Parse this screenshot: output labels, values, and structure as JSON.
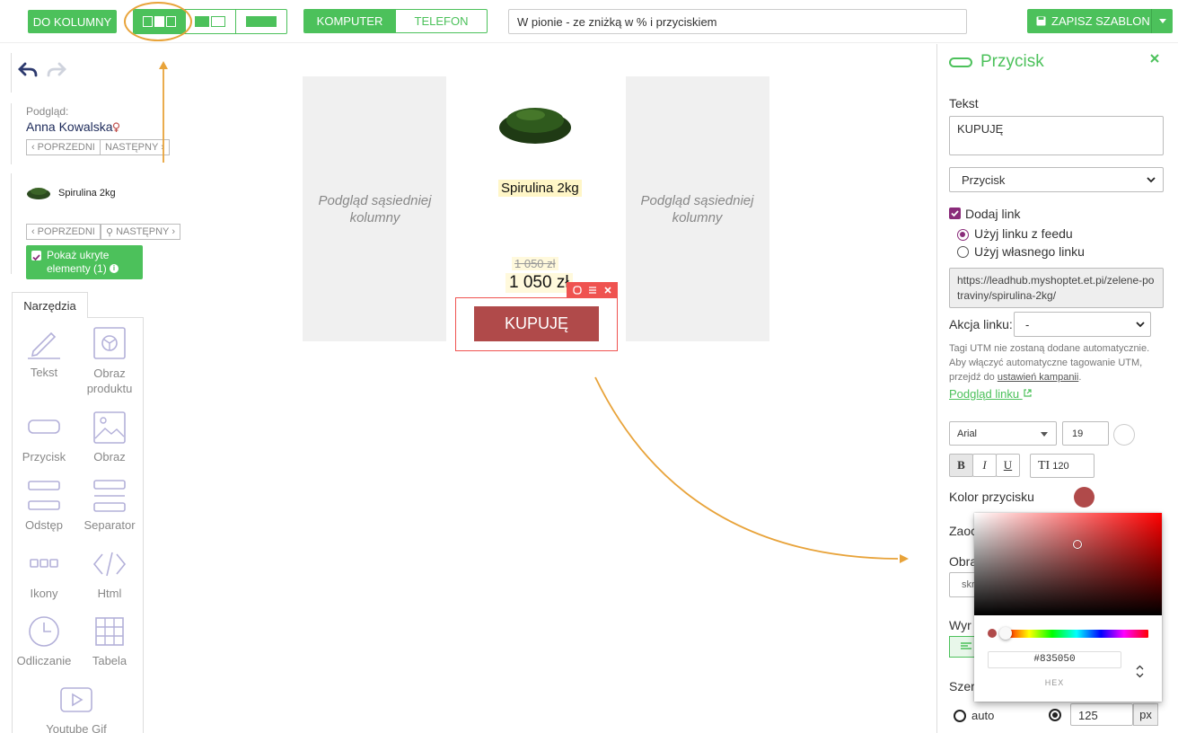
{
  "topbar": {
    "to_columns": "DO KOLUMNY",
    "device_computer": "KOMPUTER",
    "device_phone": "TELEFON",
    "template_name": "W pionie - ze zniżką w % i przyciskiem",
    "save_template": "ZAPISZ SZABLON"
  },
  "left": {
    "preview_label": "Podgląd:",
    "preview_name": "Anna Kowalska",
    "prev": "POPRZEDNI",
    "next": "NASTĘPNY",
    "product_name": "Spirulina 2kg",
    "prev2": "POPRZEDNI",
    "next2": "NASTĘPNY",
    "hidden_toggle": "Pokaż ukryte elementy (1)",
    "tools_tab": "Narzędzia",
    "tools": {
      "text": "Tekst",
      "product_image": "Obraz produktu",
      "button": "Przycisk",
      "image": "Obraz",
      "spacer": "Odstęp",
      "separator": "Separator",
      "icons": "Ikony",
      "html": "Html",
      "countdown": "Odliczanie",
      "table": "Tabela",
      "youtube": "Youtube Gif"
    }
  },
  "canvas": {
    "adjacent_preview": "Podgląd sąsiedniej kolumny",
    "product_title": "Spirulina 2kg",
    "old_price": "1 050 zł",
    "price": "1 050 zł",
    "cta": "KUPUJĘ"
  },
  "panel": {
    "title": "Przycisk",
    "text_label": "Tekst",
    "text_value": "KUPUJĘ",
    "type_select": "Przycisk",
    "add_link": "Dodaj link",
    "use_feed_link": "Użyj linku z feedu",
    "use_own_link": "Użyj własnego linku",
    "url": "https://leadhub.myshoptet.et.pi/zelene-potraviny/spirulina-2kg/",
    "link_action_label": "Akcja linku:",
    "link_action_value": "-",
    "utm_note_1": "Tagi UTM nie zostaną dodane automatycznie.",
    "utm_note_2": "Aby włączyć automatyczne tagowanie UTM,",
    "utm_note_3": "przejdź do",
    "utm_link": "ustawień kampanii",
    "utm_note_end": ".",
    "preview_link": "Podgląd linku",
    "font": "Arial",
    "font_size": "19",
    "bold": "B",
    "italic": "I",
    "underline": "U",
    "line_height_icon": "TI",
    "line_height": "120",
    "button_color_label": "Kolor przycisku",
    "cut_zaoc": "Zaoc",
    "cut_obra": "Obra",
    "cut_skr": "skr",
    "cut_wyr": "Wyr",
    "cut_szer": "Szer",
    "width_auto": "auto",
    "width_value": "125",
    "width_unit": "px",
    "hex_value": "#835050",
    "hex_label": "HEX"
  },
  "colors": {
    "green": "#4cc15b",
    "button_red": "#b04a4a",
    "orange": "#e8a33a"
  }
}
